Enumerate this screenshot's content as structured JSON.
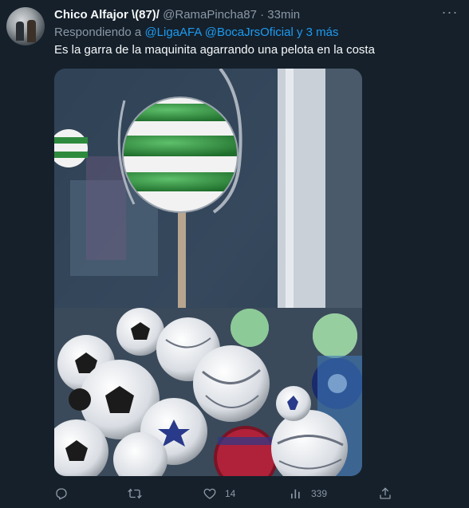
{
  "tweet": {
    "display_name": "Chico Alfajor \\(87)/",
    "handle": "@RamaPincha87",
    "separator": "·",
    "time": "33min",
    "more_label": "···",
    "reply_prefix": "Respondiendo a",
    "reply_to": [
      "@LigaAFA",
      "@BocaJrsOficial",
      "y 3 más"
    ],
    "text": "Es la garra de la maquinita agarrando una pelota en la costa",
    "media": {
      "description_icon": "video-thumbnail",
      "accent_colors": [
        "#2e8b3e",
        "#f2f2f2",
        "#1b2a6b",
        "#c6233b"
      ]
    },
    "actions": {
      "reply_count": "",
      "retweet_count": "",
      "like_count": "14",
      "view_count": "339"
    }
  },
  "colors": {
    "background": "#15202b",
    "text_primary": "#f7f9f9",
    "text_secondary": "#8b98a5",
    "link": "#1d9bf0"
  }
}
